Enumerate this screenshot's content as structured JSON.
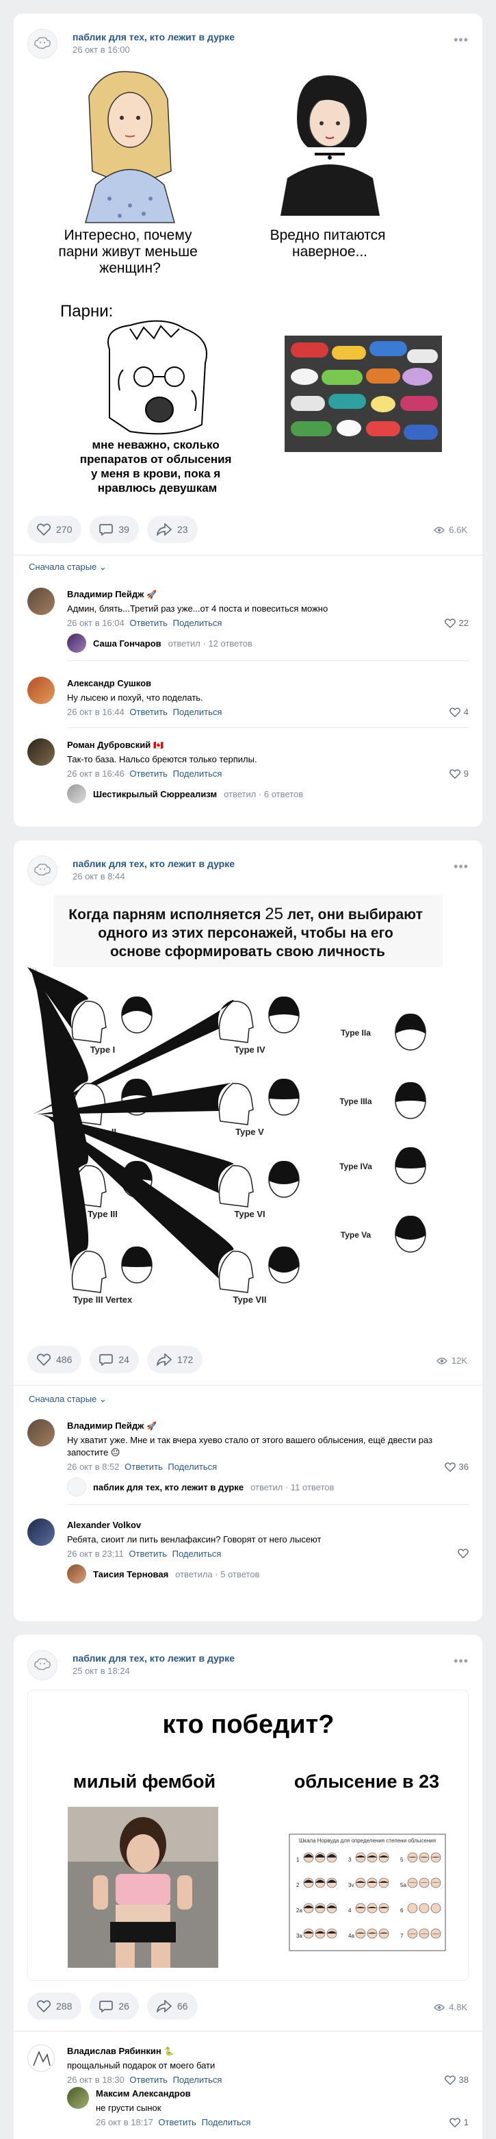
{
  "posts": [
    {
      "group": "паблик для тех, кто лежит в дурке",
      "date": "26 окт в 16:00",
      "meme": {
        "top_left": "Интересно, почему парни живут меньше женщин?",
        "top_right": "Вредно питаются наверное...",
        "label": "Парни:",
        "bottom_left": "мне неважно, сколько препаратов от облысения у меня в крови, пока я нравлюсь девушкам"
      },
      "likes": "270",
      "comments": "39",
      "shares": "23",
      "views": "6.6K",
      "sort_label": "Сначала старые",
      "comment_list": [
        {
          "name": "Владимир Пейдж",
          "badge": "🚀",
          "text": "Админ, блять...Третий раз уже...от 4 поста и повеситься можно",
          "date": "26 окт в 16:04",
          "reply": "Ответить",
          "share": "Поделиться",
          "likes": "22",
          "thread": {
            "name": "Саша Гончаров",
            "action": "ответил",
            "count": "12 ответов"
          }
        },
        {
          "name": "Александр Сушков",
          "badge": "",
          "text": "Ну лысею и похуй, что поделать.",
          "date": "26 окт в 16:44",
          "reply": "Ответить",
          "share": "Поделиться",
          "likes": "4"
        },
        {
          "name": "Роман Дубровский",
          "badge": "🇨🇦",
          "text": "Так-то база. Нальсо бреются только терпилы.",
          "date": "26 окт в 16:46",
          "reply": "Ответить",
          "share": "Поделиться",
          "likes": "9",
          "thread": {
            "name": "Шестикрылый Сюрреализм",
            "action": "ответил",
            "count": "6 ответов"
          }
        }
      ]
    },
    {
      "group": "паблик для тех, кто лежит в дурке",
      "date": "26 окт в 8:44",
      "meme": {
        "title_a": "Когда парням исполняется",
        "title_num": "25",
        "title_b": "лет, они выбирают одного из этих персонажей, чтобы на его основе сформировать свою личность",
        "types_left": [
          "Type I",
          "Type II",
          "Type III",
          "Type III Vertex"
        ],
        "types_mid": [
          "Type IV",
          "Type V",
          "Type VI",
          "Type VII"
        ],
        "types_right": [
          "Type IIa",
          "Type IIIa",
          "Type IVa",
          "Type Va"
        ]
      },
      "likes": "486",
      "comments": "24",
      "shares": "172",
      "views": "12K",
      "sort_label": "Сначала старые",
      "comment_list": [
        {
          "name": "Владимир Пейдж",
          "badge": "🚀",
          "text": "Ну хватит уже. Мне и так вчера хуево стало от этого вашего облысения, ещё двести раз запостите",
          "emoji": "😐",
          "date": "26 окт в 8:52",
          "reply": "Ответить",
          "share": "Поделиться",
          "likes": "36",
          "thread": {
            "name": "паблик для тех, кто лежит в дурке",
            "action": "ответил",
            "count": "11 ответов"
          }
        },
        {
          "name": "Alexander Volkov",
          "badge": "",
          "text": "Ребята, сиоит ли пить венлафаксин? Говорят от него лысеют",
          "date": "26 окт в 23:11",
          "reply": "Ответить",
          "share": "Поделиться",
          "likes": "",
          "thread": {
            "name": "Таисия Терновая",
            "action": "ответила",
            "count": "5 ответов"
          }
        }
      ]
    },
    {
      "group": "паблик для тех, кто лежит в дурке",
      "date": "25 окт в 18:24",
      "meme": {
        "title": "кто победит?",
        "left": "милый фембой",
        "right": "облысение в 23",
        "scale_title": "Шкала Норвуда для определения степени облысения",
        "scale_nums": [
          "1",
          "2",
          "2a",
          "3a",
          "3",
          "3v",
          "4",
          "4a",
          "5",
          "5a",
          "6",
          "7"
        ]
      },
      "likes": "288",
      "comments": "26",
      "shares": "66",
      "views": "4.8K",
      "comment_list": [
        {
          "name": "Владислав Рябинкин",
          "badge": "🐍",
          "text": "прощальный подарок от моего бати",
          "date": "26 окт в 18:30",
          "reply": "Ответить",
          "share": "Поделиться",
          "likes": "38"
        },
        {
          "name": "Максим Александров",
          "badge": "",
          "text": "не грусти сынок",
          "date": "26 окт в 18:17",
          "reply": "Ответить",
          "share": "Поделиться",
          "likes": "1"
        }
      ]
    }
  ]
}
